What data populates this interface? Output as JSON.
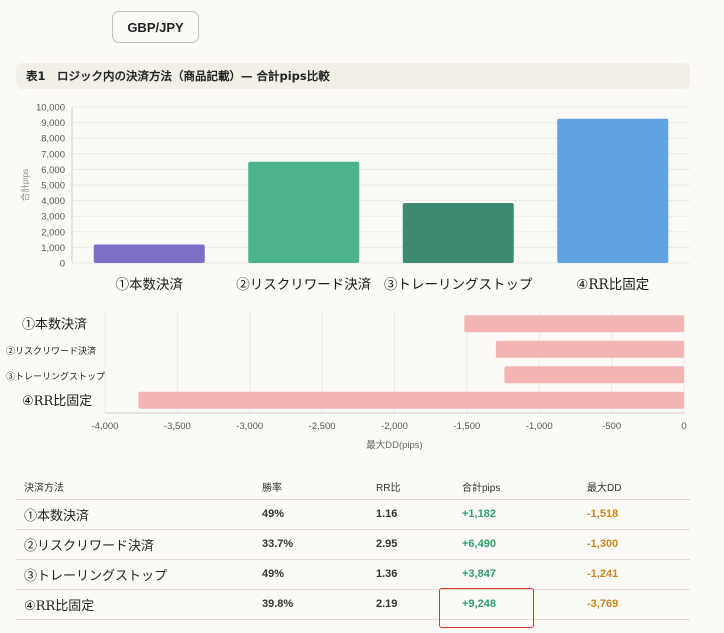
{
  "pair_button": "GBP/JPY",
  "table_title": "表1　ロジック内の決済方法（商品記載）— 合計pips比較",
  "colors": {
    "series": [
      "#7b6fc6",
      "#4db38c",
      "#3d8a72",
      "#5fa3e3"
    ],
    "dd_bar": "#f2b5b4",
    "pips_positive": "#2e9e6a",
    "dd_negative": "#c9861d",
    "highlight": "#e0302a"
  },
  "chart_data": [
    {
      "type": "bar",
      "categories": [
        "①本数決済",
        "②リスクリワード決済",
        "③トレーリングストップ",
        "④RR比固定"
      ],
      "values": [
        1182,
        6490,
        3847,
        9248
      ],
      "ylabel": "合計pips",
      "ylim": [
        0,
        10000
      ],
      "yticks": [
        "0",
        "1,000",
        "2,000",
        "3,000",
        "4,000",
        "5,000",
        "6,000",
        "7,000",
        "8,000",
        "9,000",
        "10,000"
      ],
      "grid": true
    },
    {
      "type": "bar",
      "orientation": "horizontal",
      "categories": [
        "①本数決済",
        "②リスクリワード決済",
        "③トレーリングストップ",
        "④RR比固定"
      ],
      "values": [
        -1518,
        -1300,
        -1241,
        -3769
      ],
      "xlabel": "最大DD(pips)",
      "xlim": [
        -4000,
        0
      ],
      "xticks": [
        "-4,000",
        "-3,500",
        "-3,000",
        "-2,500",
        "-2,000",
        "-1,500",
        "-1,000",
        "-500",
        "0"
      ],
      "grid": true
    }
  ],
  "table": {
    "headers": [
      "決済方法",
      "勝率",
      "RR比",
      "合計pips",
      "最大DD"
    ],
    "rows": [
      {
        "method": "①本数決済",
        "win_rate": "49%",
        "rr": "1.16",
        "pips": "+1,182",
        "dd": "-1,518"
      },
      {
        "method": "②リスクリワード決済",
        "win_rate": "33.7%",
        "rr": "2.95",
        "pips": "+6,490",
        "dd": "-1,300"
      },
      {
        "method": "③トレーリングストップ",
        "win_rate": "49%",
        "rr": "1.36",
        "pips": "+3,847",
        "dd": "-1,241"
      },
      {
        "method": "④RR比固定",
        "win_rate": "39.8%",
        "rr": "2.19",
        "pips": "+9,248",
        "dd": "-3,769"
      }
    ]
  }
}
